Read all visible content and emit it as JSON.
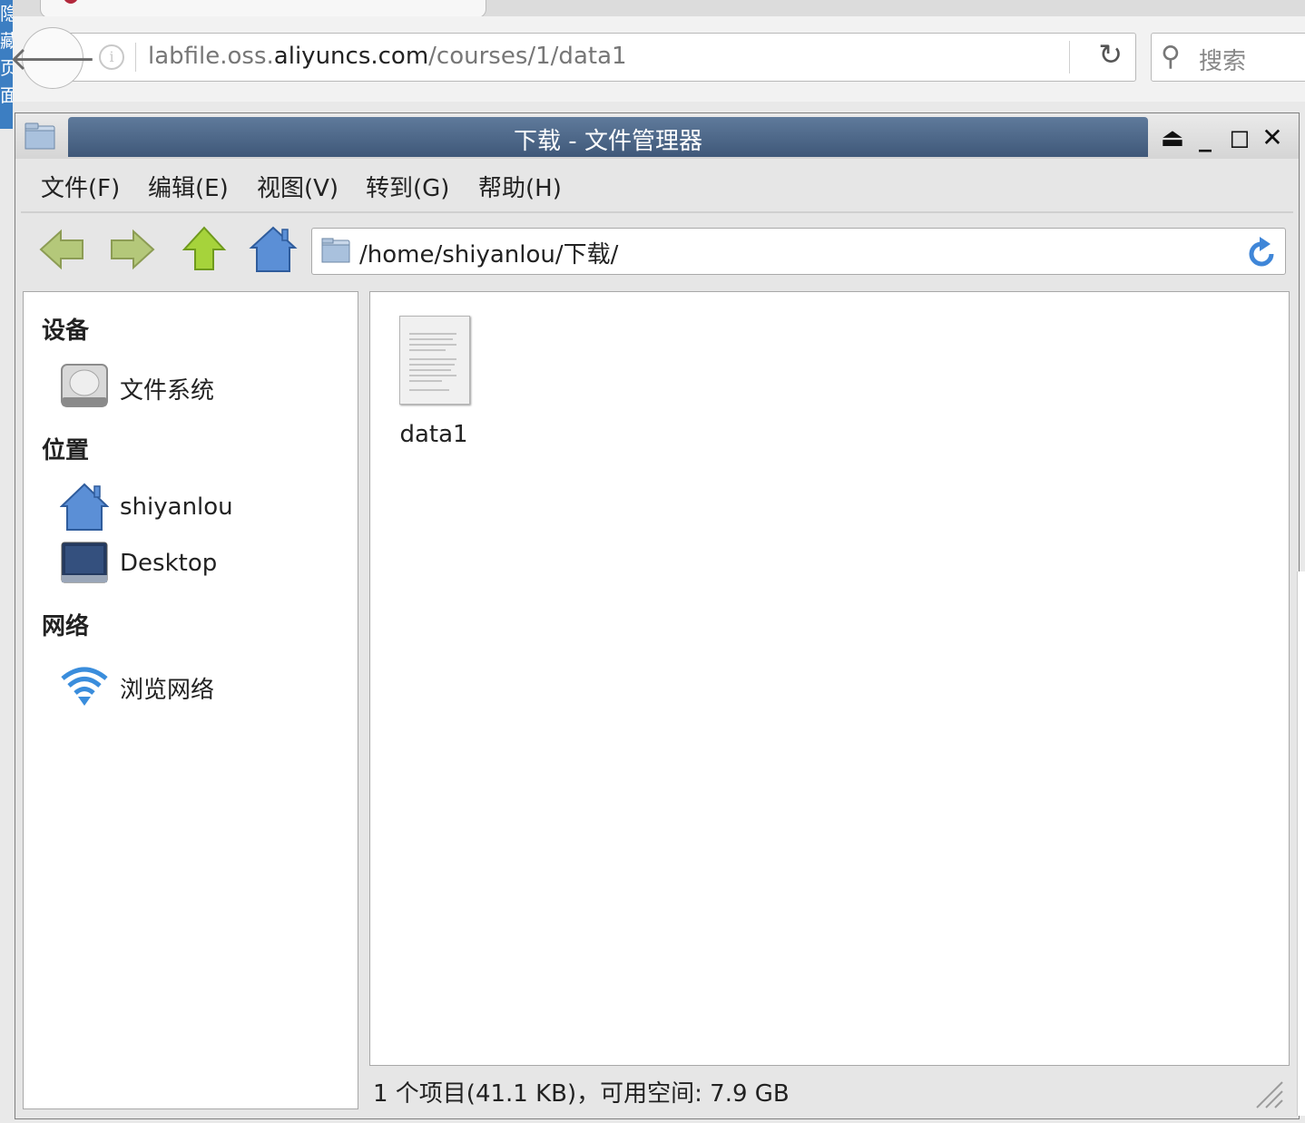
{
  "side_tab": {
    "text": "隐藏页面"
  },
  "browser": {
    "url_path_prefix": "labfile.oss.",
    "url_domain": "aliyuncs.com",
    "url_path": "/courses/1/data1",
    "search_placeholder": "搜索"
  },
  "window": {
    "title": "下载 - 文件管理器"
  },
  "menu": {
    "file": "文件(F)",
    "edit": "编辑(E)",
    "view": "视图(V)",
    "go": "转到(G)",
    "help": "帮助(H)"
  },
  "pathbar": {
    "path": "/home/shiyanlou/下载/"
  },
  "sidebar": {
    "devices_header": "设备",
    "filesystem": "文件系统",
    "places_header": "位置",
    "home": "shiyanlou",
    "desktop": "Desktop",
    "network_header": "网络",
    "browse_network": "浏览网络"
  },
  "files": [
    {
      "name": "data1",
      "icon": "text-document-icon"
    }
  ],
  "status": {
    "text": "1 个项目(41.1 KB)，可用空间: 7.9 GB"
  },
  "colors": {
    "title_bar": "#4a6485",
    "accent_blue": "#4a78bd",
    "arrow_green": "#a6c34d"
  }
}
